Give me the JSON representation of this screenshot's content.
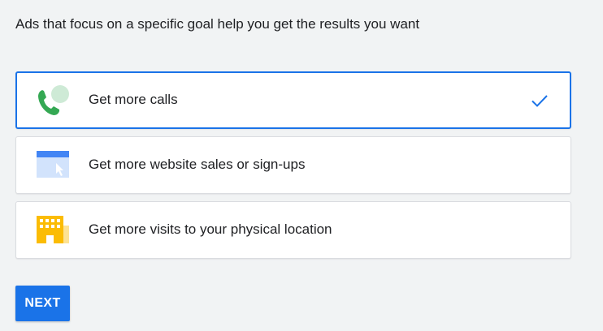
{
  "intro": {
    "text": "Ads that focus on a specific goal help you get the results you want"
  },
  "goals": [
    {
      "label": "Get more calls",
      "icon": "phone-call-icon",
      "selected": true
    },
    {
      "label": "Get more website sales or sign-ups",
      "icon": "website-cursor-icon",
      "selected": false
    },
    {
      "label": "Get more visits to your physical location",
      "icon": "building-icon",
      "selected": false
    }
  ],
  "next_button": {
    "label": "NEXT"
  },
  "colors": {
    "accent": "#1a73e8",
    "background": "#f1f3f4",
    "card": "#ffffff",
    "phone_green": "#34a853",
    "bubble_green": "#ceead6",
    "web_blue": "#4285f4",
    "web_light_blue": "#d2e3fc",
    "building_yellow": "#fbbc04",
    "building_light_yellow": "#fde293"
  }
}
